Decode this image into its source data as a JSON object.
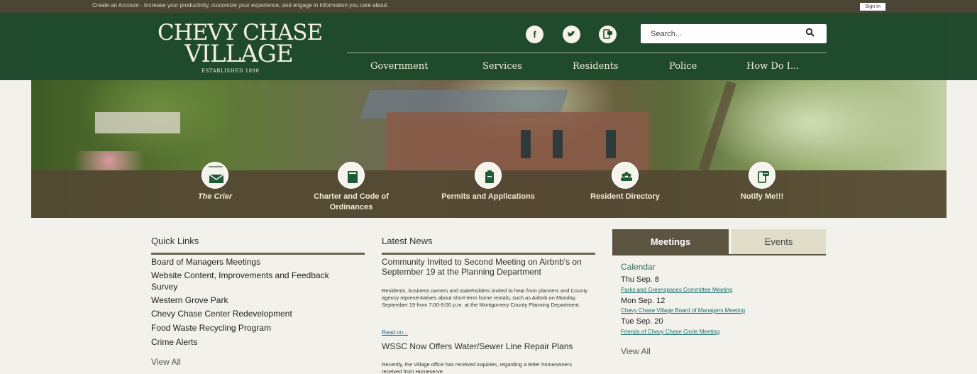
{
  "topbar": {
    "promo": "Create an Account - Increase your productivity, customize your experience, and engage in information you care about.",
    "signin": "Sign In"
  },
  "logo": {
    "line1": "CHEVY CHASE",
    "line2": "VILLAGE",
    "line3": "ESTABLISHED 1890"
  },
  "social": [
    {
      "icon": "facebook-icon",
      "glyph": "f"
    },
    {
      "icon": "twitter-icon",
      "glyph": "•"
    },
    {
      "icon": "notify-icon",
      "glyph": "□"
    }
  ],
  "search": {
    "placeholder": "Search..."
  },
  "nav": [
    "Government",
    "Services",
    "Residents",
    "Police",
    "How Do I..."
  ],
  "quick_icons": [
    {
      "label": "The Crier",
      "tag": "Newsletter"
    },
    {
      "label": "Charter and Code of Ordinances"
    },
    {
      "label": "Permits and Applications"
    },
    {
      "label": "Resident Directory"
    },
    {
      "label": "Notify Me!!!"
    }
  ],
  "quick_links": {
    "title": "Quick Links",
    "items": [
      "Board of Managers Meetings",
      "Website Content, Improvements and Feedback Survey",
      "Western Grove Park",
      "Chevy Chase Center Redevelopment",
      "Food Waste Recycling Program",
      "Crime Alerts"
    ],
    "view_all": "View All"
  },
  "news": {
    "title": "Latest News",
    "items": [
      {
        "headline": "Community Invited to Second Meeting on Airbnb's on September 19 at the Planning Department",
        "body": "Residents, business owners and stakeholders invited to hear from planners and County agency representatives about short-term home rentals, such as Airbnb on Monday, September 19 from 7:00-9:00 p.m. at the Montgomery County Planning Department.",
        "link": "Read on..."
      },
      {
        "headline": "WSSC Now Offers Water/Sewer Line Repair Plans",
        "body": "Recently, the Village office has received inquiries, regarding a letter homeowners received from Homeserve"
      }
    ]
  },
  "calendar": {
    "tabs": [
      "Meetings",
      "Events"
    ],
    "heading": "Calendar",
    "entries": [
      {
        "date": "Thu Sep. 8",
        "event": "Parks and Greenspaces Committee Meeting"
      },
      {
        "date": "Mon Sep. 12",
        "event": "Chevy Chase Village Board of Managers Meeting"
      },
      {
        "date": "Tue Sep. 20",
        "event": "Friends of Chevy Chase Circle Meeting"
      }
    ],
    "view_all": "View All"
  },
  "colors": {
    "header_green": "#1f4a2b",
    "quick_bar_brown": "#544832",
    "tab_active": "#5b5440",
    "link_teal": "#1a6f6c"
  }
}
